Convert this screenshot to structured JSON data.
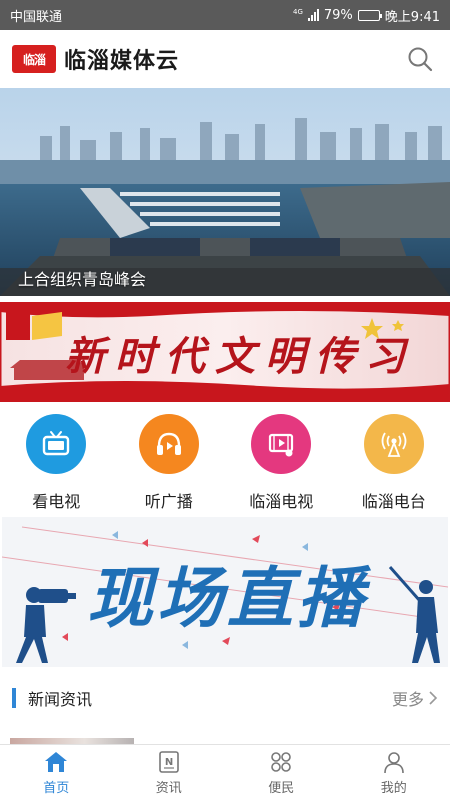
{
  "status_bar": {
    "carrier": "中国联通",
    "network": "4G",
    "battery_percent": "79%",
    "battery_level": 0.79,
    "time": "晚上9:41"
  },
  "header": {
    "logo_text": "临淄",
    "title": "临淄媒体云"
  },
  "hero": {
    "caption": "上合组织青岛峰会"
  },
  "civ_banner": {
    "text": "新时代文明传习"
  },
  "grid": {
    "items": [
      {
        "label": "看电视",
        "icon": "tv-icon",
        "color": "#1f9be0"
      },
      {
        "label": "听广播",
        "icon": "headphones-icon",
        "color": "#f5871f"
      },
      {
        "label": "临淄电视",
        "icon": "video-play-icon",
        "color": "#e4387f"
      },
      {
        "label": "临淄电台",
        "icon": "radio-tower-icon",
        "color": "#f3b74a"
      }
    ]
  },
  "live_banner": {
    "text": "现场直播"
  },
  "news": {
    "title": "新闻资讯",
    "more": "更多"
  },
  "tabs": [
    {
      "label": "首页",
      "icon": "home-icon",
      "active": true
    },
    {
      "label": "资讯",
      "icon": "news-icon",
      "active": false
    },
    {
      "label": "便民",
      "icon": "grid-icon",
      "active": false
    },
    {
      "label": "我的",
      "icon": "user-icon",
      "active": false
    }
  ],
  "colors": {
    "accent": "#2f86d6",
    "brand_red": "#d6201f",
    "live_blue": "#1f6fb6"
  }
}
